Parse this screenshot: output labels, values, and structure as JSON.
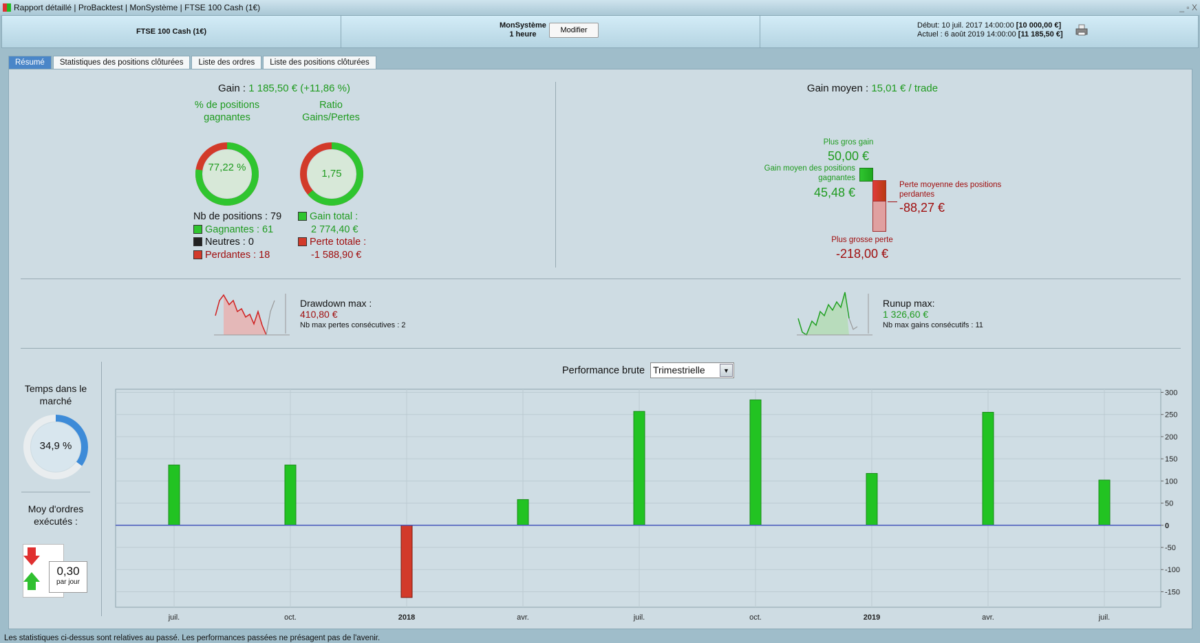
{
  "window": {
    "title": "Rapport détaillé | ProBacktest | MonSystème | FTSE 100 Cash (1€)",
    "controls": [
      "_",
      "▫",
      "X"
    ]
  },
  "header": {
    "instrument": "FTSE 100 Cash (1€)",
    "system": "MonSystème",
    "timeframe": "1 heure",
    "modify_label": "Modifier",
    "start_label": "Début:",
    "start_date": "10 juil. 2017 14:00:00",
    "start_value": "[10 000,00 €]",
    "current_label": "Actuel :",
    "current_date": "6 août 2019 14:00:00",
    "current_value": "[11 185,50 €]",
    "print_icon": "printer-icon"
  },
  "tabs": [
    {
      "label": "Résumé",
      "active": true
    },
    {
      "label": "Statistiques des positions clôturées"
    },
    {
      "label": "Liste des ordres"
    },
    {
      "label": "Liste des positions clôturées"
    }
  ],
  "summary": {
    "gain_label": "Gain :",
    "gain_value": "1 185,50 € (+11,86 %)",
    "win_pct_title": "% de positions gagnantes",
    "win_pct": "77,22 %",
    "win_pct_value": 77.22,
    "ratio_title": "Ratio Gains/Pertes",
    "ratio": "1,75",
    "ratio_gain_fraction": 0.636,
    "nb_positions": "Nb de positions : 79",
    "winners": "Gagnantes : 61",
    "neutral": "Neutres : 0",
    "losers": "Perdantes : 18",
    "total_gain_label": "Gain total :",
    "total_gain": "2 774,40 €",
    "total_loss_label": "Perte totale :",
    "total_loss": "-1 588,90 €",
    "avg_gain_label": "Gain moyen :",
    "avg_gain": "15,01 € / trade",
    "best_label": "Plus gros gain",
    "best": "50,00 €",
    "avg_win_label": "Gain moyen des positions gagnantes",
    "avg_win": "45,48 €",
    "avg_loss_label": "Perte moyenne des positions perdantes",
    "avg_loss": "-88,27 €",
    "worst_label": "Plus grosse perte",
    "worst": "-218,00 €"
  },
  "drawdown": {
    "label": "Drawdown max :",
    "value": "410,80 €",
    "sub": "Nb max pertes consécutives : 2"
  },
  "runup": {
    "label": "Runup max:",
    "value": "1 326,60 €",
    "sub": "Nb max gains consécutifs : 11"
  },
  "market": {
    "label": "Temps dans le marché",
    "value": "34,9 %",
    "fraction": 0.349
  },
  "orders": {
    "label": "Moy d'ordres exécutés :",
    "value": "0,30",
    "unit": "par jour"
  },
  "performance": {
    "label": "Performance brute",
    "period": "Trimestrielle"
  },
  "chart_data": {
    "type": "bar",
    "categories": [
      "juil.",
      "oct.",
      "2018",
      "avr.",
      "juil.",
      "oct.",
      "2019",
      "avr.",
      "juil."
    ],
    "bold_categories": [
      "2018",
      "2019"
    ],
    "values": [
      136,
      136,
      -163,
      58,
      257,
      283,
      117,
      255,
      102
    ],
    "ylim": [
      -185,
      307
    ],
    "yticks": [
      300,
      250,
      200,
      150,
      100,
      50,
      0,
      -50,
      -100,
      -150
    ],
    "grid": true,
    "colors": {
      "positive": "#22c322",
      "negative": "#d23a2a",
      "zero_line": "#4455bb"
    }
  },
  "footer": "Les statistiques ci-dessus sont relatives au passé. Les performances passées ne présagent pas de l'avenir."
}
